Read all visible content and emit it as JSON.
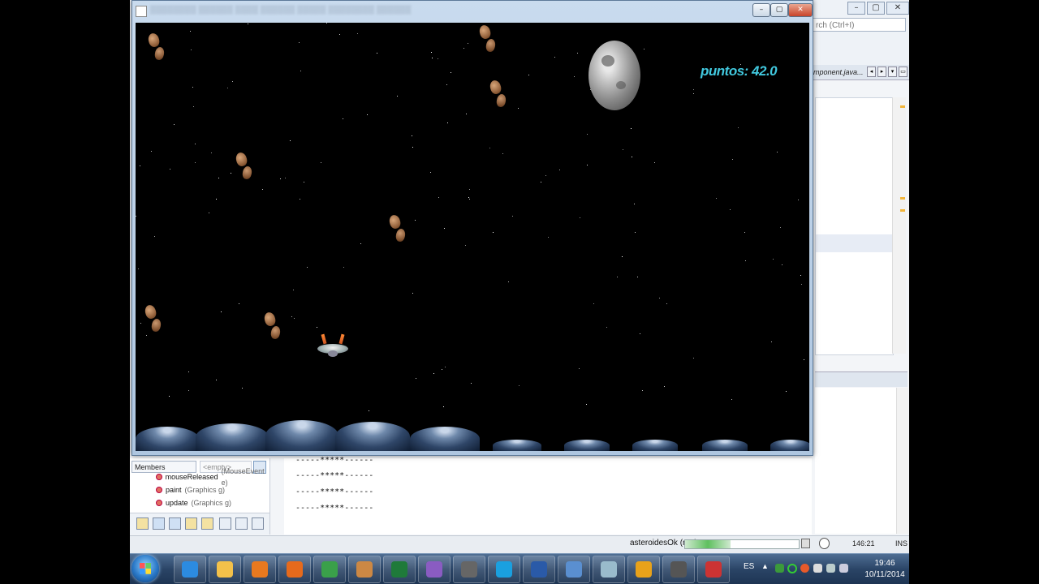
{
  "ide": {
    "search_placeholder": "rch (Ctrl+I)",
    "editor_tab": "mponent.java...",
    "navigator": {
      "filter_select": "Members",
      "filter_input": "<empty>",
      "items": [
        {
          "name": "mouseReleased",
          "params": "(MouseEvent e)"
        },
        {
          "name": "paint",
          "params": "(Graphics g)"
        },
        {
          "name": "update",
          "params": "(Graphics g)"
        }
      ]
    },
    "output_lines": [
      "-----*****------",
      "-----*****------",
      "-----*****------",
      "-----*****------"
    ],
    "status": {
      "run_label": "asteroidesOk (run)",
      "progress": 0.4,
      "caret_position": "146:21",
      "insert_mode": "INS"
    }
  },
  "game": {
    "score_text": "puntos: 42.0",
    "score_color": "#41c8de"
  },
  "taskbar": {
    "pinned_apps": [
      "ie-icon",
      "explorer-icon",
      "media-player-icon",
      "firefox-icon",
      "chrome-icon",
      "app-grid-icon",
      "excel-icon",
      "pidgin-icon",
      "keepass-icon",
      "skype-icon",
      "word-icon",
      "virtualbox-icon",
      "notepad-icon",
      "outlook-icon",
      "sublime-icon",
      "java-icon"
    ],
    "language": "ES",
    "time": "19:46",
    "date": "10/11/2014"
  }
}
